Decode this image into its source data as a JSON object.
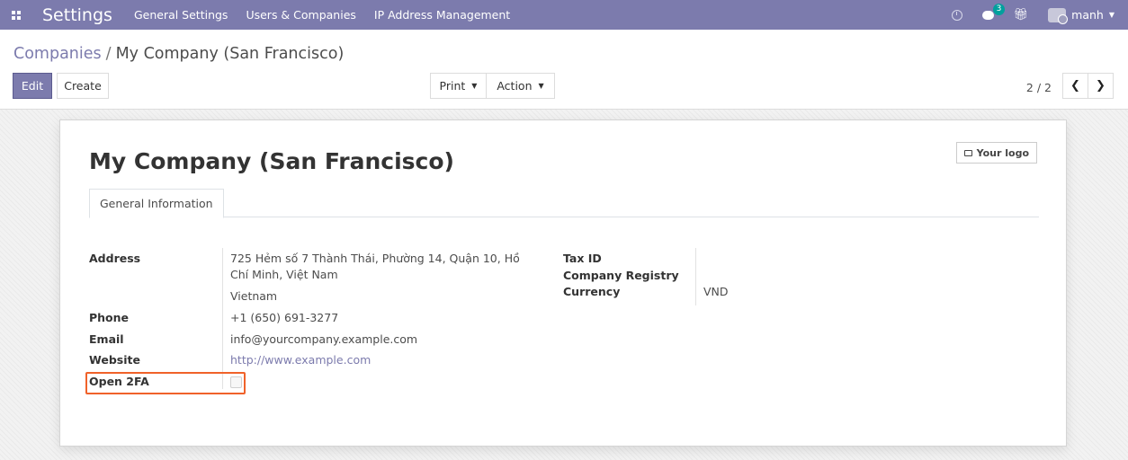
{
  "navbar": {
    "app_title": "Settings",
    "menu": [
      "General Settings",
      "Users & Companies",
      "IP Address Management"
    ],
    "chat_count": "3",
    "user": "manh"
  },
  "control_panel": {
    "breadcrumb_parent": "Companies",
    "breadcrumb_separator": "/",
    "breadcrumb_current": "My Company (San Francisco)",
    "edit_label": "Edit",
    "create_label": "Create",
    "print_label": "Print",
    "action_label": "Action",
    "pager_value": "2 / 2"
  },
  "form": {
    "company_name": "My Company (San Francisco)",
    "logo_label": "Your logo",
    "tab_label": "General Information",
    "address_label": "Address",
    "address_line1": "725 Hẻm số 7 Thành Thái, Phường 14, Quận 10, Hồ",
    "address_line2": "Chí Minh, Việt Nam",
    "address_country": "Vietnam",
    "phone_label": "Phone",
    "phone_value": "+1 (650) 691-3277",
    "email_label": "Email",
    "email_value": "info@yourcompany.example.com",
    "website_label": "Website",
    "website_value": "http://www.example.com",
    "open2fa_label": "Open 2FA",
    "open2fa_checked": false,
    "taxid_label": "Tax ID",
    "registry_label": "Company Registry",
    "currency_label": "Currency",
    "currency_value": "VND"
  },
  "colors": {
    "brand": "#7c7bad",
    "highlight": "#f0622a",
    "badge": "#00a09d"
  }
}
